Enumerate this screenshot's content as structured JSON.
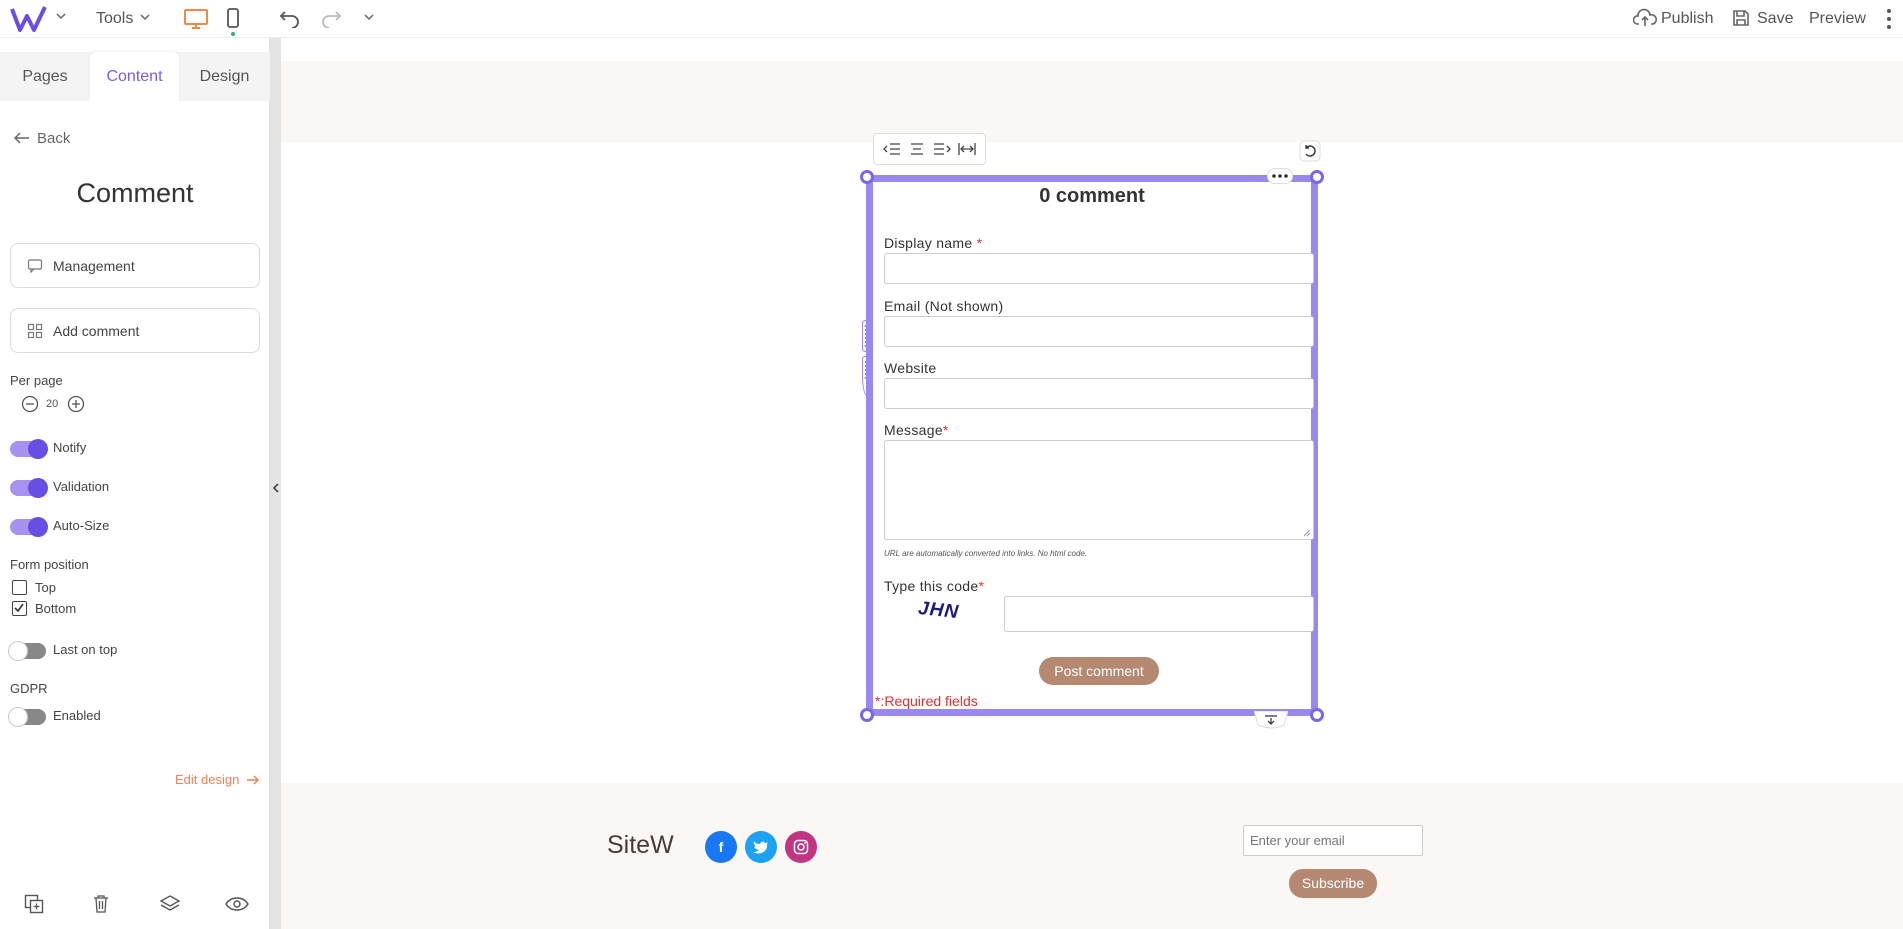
{
  "topbar": {
    "logo": "W",
    "tools_label": "Tools",
    "publish_label": "Publish",
    "save_label": "Save",
    "preview_label": "Preview"
  },
  "sidebar": {
    "tabs": [
      {
        "label": "Pages",
        "active": false
      },
      {
        "label": "Content",
        "active": true
      },
      {
        "label": "Design",
        "active": false
      }
    ],
    "back_label": "Back",
    "title": "Comment",
    "management_label": "Management",
    "add_comment_label": "Add comment",
    "per_page_label": "Per page",
    "per_page_value": "20",
    "toggles": [
      {
        "label": "Notify",
        "on": true
      },
      {
        "label": "Validation",
        "on": true
      },
      {
        "label": "Auto-Size",
        "on": true
      }
    ],
    "form_position_label": "Form position",
    "form_position_options": [
      {
        "label": "Top",
        "checked": false
      },
      {
        "label": "Bottom",
        "checked": true
      }
    ],
    "last_on_top_label": "Last on top",
    "gdpr_label": "GDPR",
    "gdpr_enabled_label": "Enabled",
    "edit_design_label": "Edit design"
  },
  "widget": {
    "title": "0 comment",
    "display_name_label": "Display name",
    "email_label": "Email (Not shown)",
    "website_label": "Website",
    "message_label": "Message",
    "url_note": "URL are automatically converted into links. No html code.",
    "code_label": "Type this code",
    "captcha": "JHN",
    "post_button": "Post comment",
    "required_note": "*:Required fields"
  },
  "footer": {
    "brand": "SiteW",
    "email_placeholder": "Enter your email",
    "subscribe_label": "Subscribe"
  },
  "colors": {
    "accent": "#7b5ce6",
    "selection": "#9b88ee",
    "button": "#b58872",
    "facebook": "#1877f2",
    "twitter": "#1da1f2",
    "instagram": "#c13584",
    "edit_design": "#f0805a"
  }
}
